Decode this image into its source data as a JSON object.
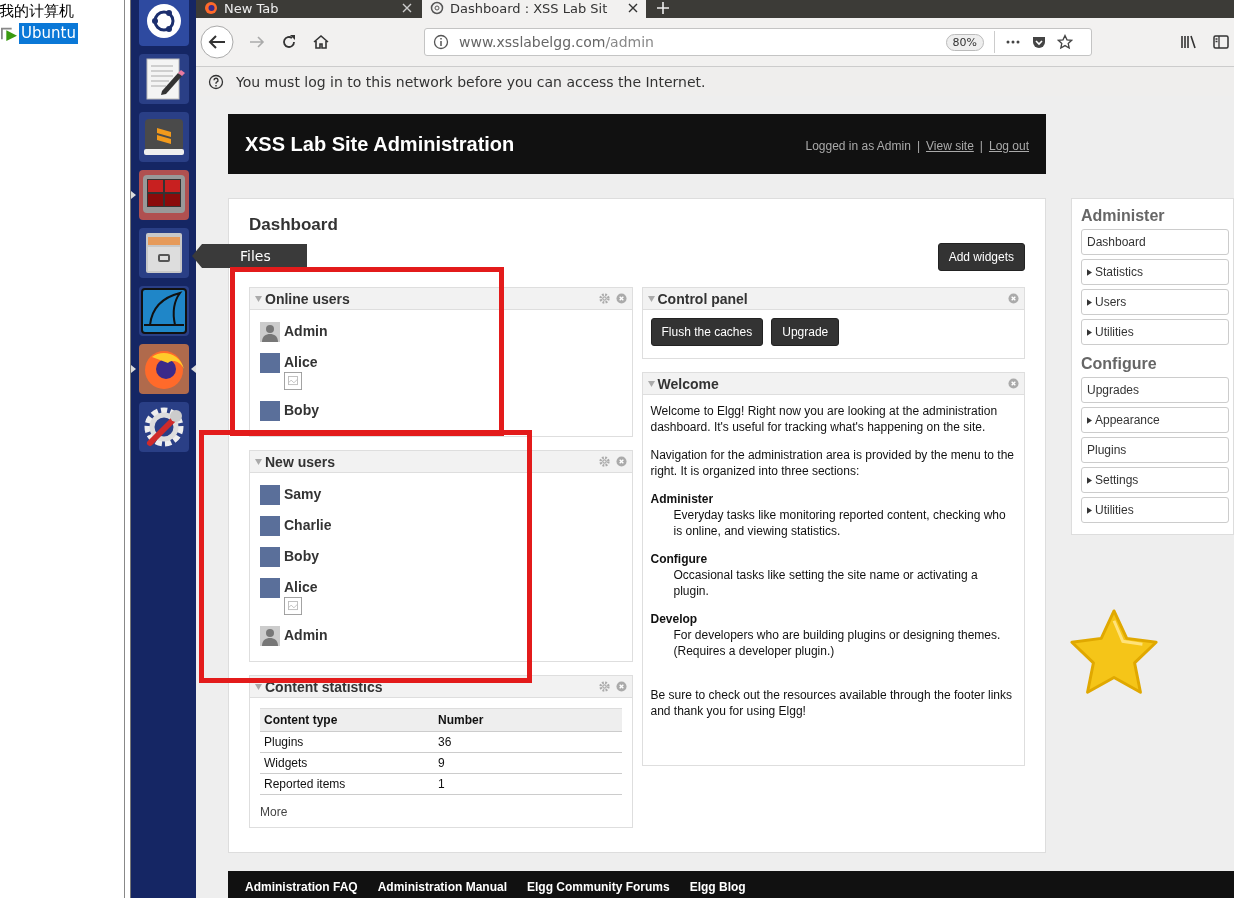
{
  "desktop": {
    "items": [
      {
        "label": "我的计算机",
        "selected": false
      },
      {
        "label": "Ubuntu",
        "selected": true
      }
    ]
  },
  "launcher": {
    "items": [
      {
        "kind": "ubuntu",
        "running": false,
        "focused": false
      },
      {
        "kind": "editor",
        "running": false,
        "focused": false
      },
      {
        "kind": "sublime",
        "running": false,
        "focused": false
      },
      {
        "kind": "terminal",
        "running": true,
        "focused": false
      },
      {
        "kind": "files",
        "running": false,
        "focused": false
      },
      {
        "kind": "wireshark",
        "running": false,
        "focused": false
      },
      {
        "kind": "firefox",
        "running": true,
        "focused": true
      },
      {
        "kind": "settings",
        "running": false,
        "focused": false
      }
    ],
    "tooltip": "Files"
  },
  "browser": {
    "tabs": [
      {
        "title": "New Tab",
        "selected": false
      },
      {
        "title": "Dashboard : XSS Lab Sit",
        "selected": true
      }
    ],
    "url_host": "www.xsslabelgg.com",
    "url_path": "/admin",
    "zoom": "80%",
    "notice": "You must log in to this network before you can access the Internet."
  },
  "header": {
    "title": "XSS Lab Site Administration",
    "items": [
      {
        "kind": "text",
        "text": "Logged in as Admin"
      },
      {
        "kind": "separator",
        "text": "|"
      },
      {
        "kind": "link",
        "text": "View site"
      },
      {
        "kind": "separator",
        "text": "|"
      },
      {
        "kind": "link",
        "text": "Log out"
      }
    ]
  },
  "dashboard": {
    "title": "Dashboard",
    "add_button": "Add widgets",
    "columns": [
      [
        {
          "kind": "users",
          "title": "Online users",
          "settings": true,
          "users": [
            {
              "name": "Admin",
              "default_avatar": true,
              "broken_image": false
            },
            {
              "name": "Alice",
              "default_avatar": false,
              "broken_image": true
            },
            {
              "name": "Boby",
              "default_avatar": false,
              "broken_image": false
            }
          ]
        },
        {
          "kind": "users",
          "title": "New users",
          "settings": true,
          "users": [
            {
              "name": "Samy",
              "default_avatar": false,
              "broken_image": false
            },
            {
              "name": "Charlie",
              "default_avatar": false,
              "broken_image": false
            },
            {
              "name": "Boby",
              "default_avatar": false,
              "broken_image": false
            },
            {
              "name": "Alice",
              "default_avatar": false,
              "broken_image": true
            },
            {
              "name": "Admin",
              "default_avatar": true,
              "broken_image": false
            }
          ]
        },
        {
          "kind": "stats",
          "title": "Content statistics",
          "settings": true,
          "columns": [
            "Content type",
            "Number"
          ],
          "rows": [
            [
              "Plugins",
              "36"
            ],
            [
              "Widgets",
              "9"
            ],
            [
              "Reported items",
              "1"
            ]
          ],
          "more": "More"
        }
      ],
      [
        {
          "kind": "control",
          "title": "Control panel",
          "settings": false,
          "buttons": [
            "Flush the caches",
            "Upgrade"
          ]
        },
        {
          "kind": "welcome",
          "title": "Welcome",
          "settings": false,
          "intro": [
            "Welcome to Elgg! Right now you are looking at the administration dashboard. It's useful for tracking what's happening on the site.",
            "Navigation for the administration area is provided by the menu to the right. It is organized into three sections:"
          ],
          "sections": [
            {
              "term": "Administer",
              "desc": "Everyday tasks like monitoring reported content, checking who is online, and viewing statistics."
            },
            {
              "term": "Configure",
              "desc": "Occasional tasks like setting the site name or activating a plugin."
            },
            {
              "term": "Develop",
              "desc": "For developers who are building plugins or designing themes. (Requires a developer plugin.)"
            }
          ],
          "outro": "Be sure to check out the resources available through the footer links and thank you for using Elgg!"
        }
      ]
    ]
  },
  "sidebar": {
    "groups": [
      {
        "title": "Administer",
        "items": [
          {
            "label": "Dashboard",
            "expandable": false
          },
          {
            "label": "Statistics",
            "expandable": true
          },
          {
            "label": "Users",
            "expandable": true
          },
          {
            "label": "Utilities",
            "expandable": true
          }
        ]
      },
      {
        "title": "Configure",
        "items": [
          {
            "label": "Upgrades",
            "expandable": false
          },
          {
            "label": "Appearance",
            "expandable": true
          },
          {
            "label": "Plugins",
            "expandable": false
          },
          {
            "label": "Settings",
            "expandable": true
          },
          {
            "label": "Utilities",
            "expandable": true
          }
        ]
      }
    ]
  },
  "footer": {
    "links": [
      "Administration FAQ",
      "Administration Manual",
      "Elgg Community Forums",
      "Elgg Blog"
    ]
  }
}
